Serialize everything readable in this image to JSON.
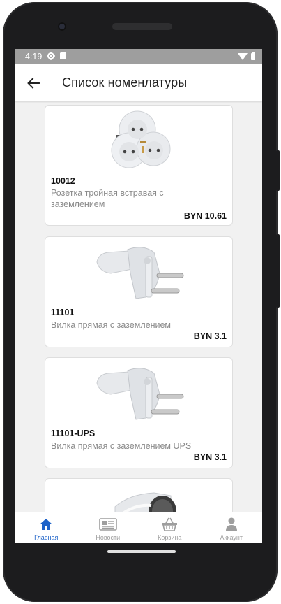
{
  "status_bar": {
    "time": "4:19",
    "icons": [
      "gear-icon",
      "sd-card-icon",
      "wifi-icon",
      "battery-icon"
    ]
  },
  "app_bar": {
    "title": "Список номенлатуры",
    "back_icon": "arrow-left-icon"
  },
  "products": [
    {
      "code": "10012",
      "name": "Розетка тройная встравая с заземлением",
      "price": "BYN 10.61",
      "image": "triple-socket-adapter"
    },
    {
      "code": "11101",
      "name": "Вилка прямая с заземлением",
      "price": "BYN 3.1",
      "image": "grounded-plug"
    },
    {
      "code": "11101-UPS",
      "name": "Вилка прямая с заземлением UPS",
      "price": "BYN 3.1",
      "image": "grounded-plug"
    },
    {
      "code": "",
      "name": "",
      "price": "",
      "image": "socket-partial"
    }
  ],
  "bottom_nav": {
    "items": [
      {
        "label": "Главная",
        "icon": "home-icon",
        "active": true
      },
      {
        "label": "Новости",
        "icon": "newspaper-icon",
        "active": false
      },
      {
        "label": "Корзина",
        "icon": "basket-icon",
        "active": false
      },
      {
        "label": "Аккаунт",
        "icon": "person-icon",
        "active": false
      }
    ]
  },
  "colors": {
    "accent": "#1e63c9",
    "inactive": "#9e9e9e",
    "status_bar": "#9e9e9e",
    "background": "#f1f1f1"
  }
}
